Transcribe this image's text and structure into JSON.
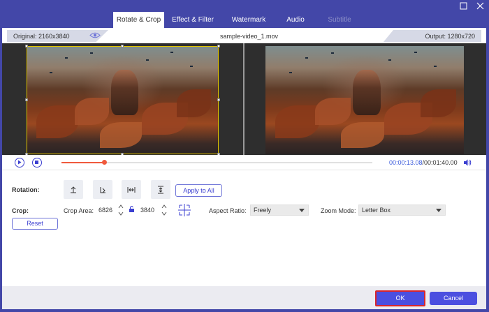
{
  "tabs": [
    {
      "label": "Rotate & Crop",
      "state": "active"
    },
    {
      "label": "Effect & Filter",
      "state": "normal"
    },
    {
      "label": "Watermark",
      "state": "normal"
    },
    {
      "label": "Audio",
      "state": "normal"
    },
    {
      "label": "Subtitle",
      "state": "disabled"
    }
  ],
  "window_controls": {
    "maximize_icon": "maximize-icon",
    "close_icon": "close-icon"
  },
  "info": {
    "original": "Original: 2160x3840",
    "filename": "sample-video_1.mov",
    "output": "Output: 1280x720"
  },
  "playback": {
    "current_time": "00:00:13.08",
    "total_time": "/00:01:40.00",
    "progress_fraction": 0.138
  },
  "rotation": {
    "label": "Rotation:",
    "buttons": [
      "rotate-left-icon",
      "rotate-right-icon",
      "flip-horizontal-icon",
      "flip-vertical-icon"
    ],
    "apply_all": "Apply to All"
  },
  "crop": {
    "label": "Crop:",
    "area_label": "Crop Area:",
    "width": "6826",
    "height": "3840",
    "aspect_label": "Aspect Ratio:",
    "aspect_value": "Freely",
    "zoom_label": "Zoom Mode:",
    "zoom_value": "Letter Box",
    "reset": "Reset"
  },
  "footer": {
    "ok": "OK",
    "cancel": "Cancel"
  },
  "colors": {
    "brand": "#4347a8",
    "accent": "#4b4fe0",
    "progress": "#f05a3d",
    "highlight": "#d9252b"
  }
}
